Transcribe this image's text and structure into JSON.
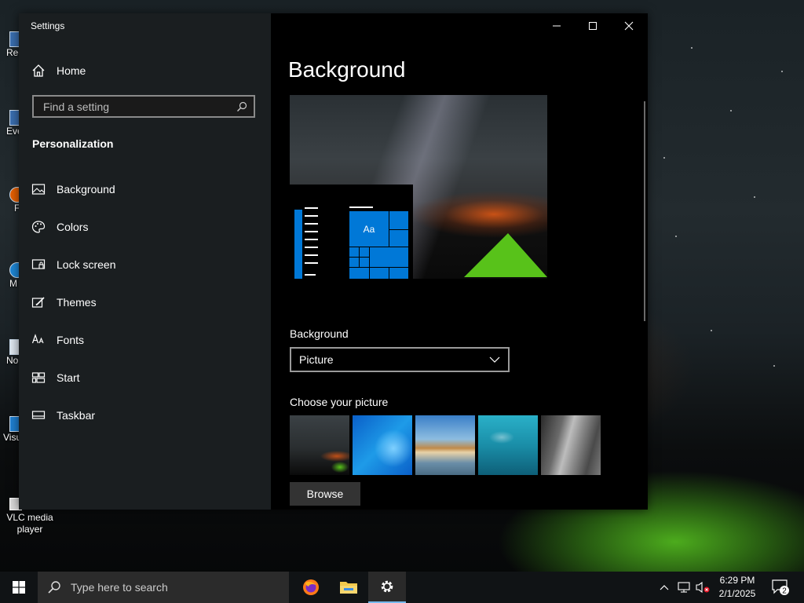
{
  "desktop": {
    "icons": [
      {
        "label": "Rec"
      },
      {
        "label": "Eve"
      },
      {
        "label": "F"
      },
      {
        "label": "M"
      },
      {
        "label": "No"
      },
      {
        "label": "Visu"
      }
    ],
    "vlc_label": "VLC media player"
  },
  "window": {
    "title": "Settings",
    "home_label": "Home",
    "search_placeholder": "Find a setting",
    "section_title": "Personalization",
    "nav": [
      {
        "label": "Background",
        "icon": "picture-icon"
      },
      {
        "label": "Colors",
        "icon": "palette-icon"
      },
      {
        "label": "Lock screen",
        "icon": "lock-screen-icon"
      },
      {
        "label": "Themes",
        "icon": "brush-icon"
      },
      {
        "label": "Fonts",
        "icon": "font-icon"
      },
      {
        "label": "Start",
        "icon": "start-icon"
      },
      {
        "label": "Taskbar",
        "icon": "taskbar-icon"
      }
    ],
    "controls": {
      "minimize": "minimize",
      "maximize": "maximize",
      "close": "close"
    }
  },
  "content": {
    "title": "Background",
    "preview_tile_label": "Aa",
    "background_label": "Background",
    "background_value": "Picture",
    "choose_label": "Choose your picture",
    "browse_label": "Browse",
    "thumbnails": [
      "night-sky-tent",
      "windows-blue",
      "beach-sunset",
      "underwater-swimmer",
      "rock-cliff"
    ]
  },
  "taskbar": {
    "search_placeholder": "Type here to search",
    "apps": [
      "firefox-icon",
      "file-explorer-icon",
      "settings-icon"
    ],
    "time": "6:29 PM",
    "date": "2/1/2025",
    "notification_count": "2"
  },
  "colors": {
    "accent": "#0078d7",
    "tent": "#58c21a",
    "window_bg": "#000000",
    "sidebar_bg": "#1c2022"
  }
}
